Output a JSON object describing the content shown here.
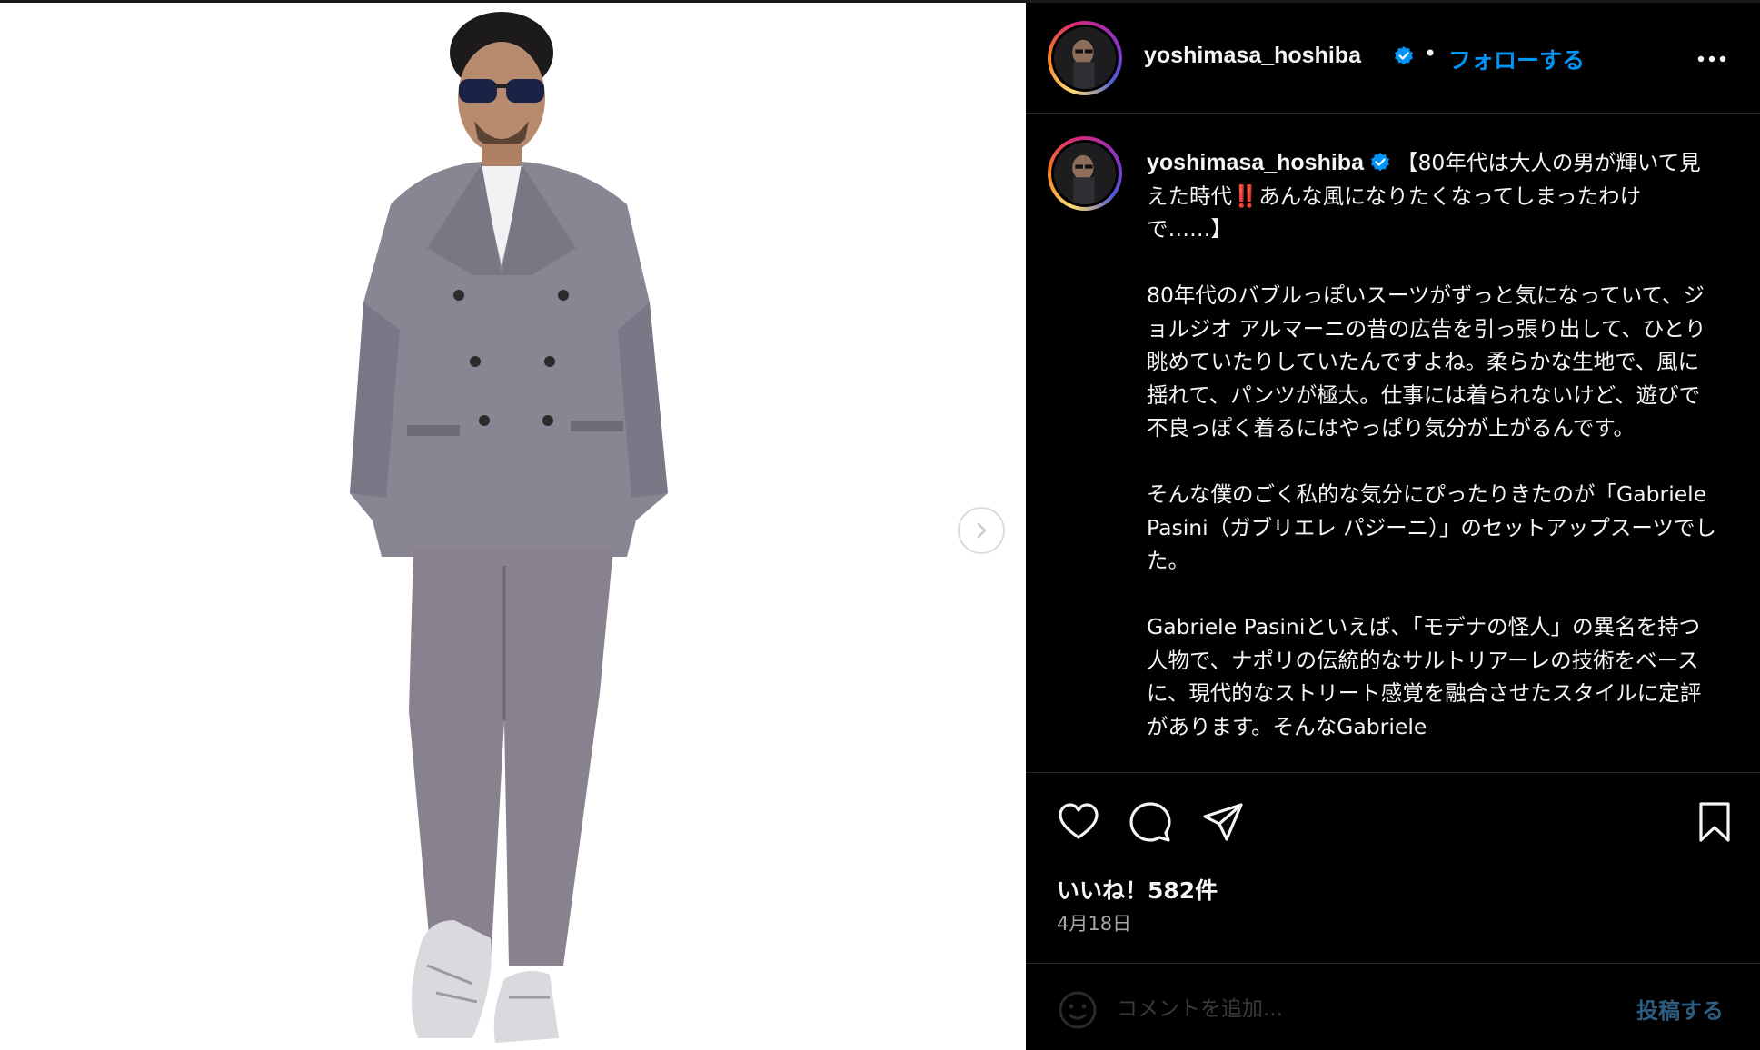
{
  "post": {
    "username": "yoshimasa_hoshiba",
    "separator": "•",
    "follow_label": "フォローする",
    "more_icon": "more-horizontal-icon",
    "verified_icon": "verified-badge-icon"
  },
  "caption": {
    "username": "yoshimasa_hoshiba",
    "line1_a": "【80年代は大人の男が輝いて見えた時代",
    "emoji_double_exclamation": "‼️",
    "line1_b": "あんな風になりたくなってしまったわけで……】",
    "para1": "80年代のバブルっぽいスーツがずっと気になっていて、ジョルジオ アルマーニの昔の広告を引っ張り出して、ひとり眺めていたりしていたんですよね。柔らかな生地で、風に揺れて、パンツが極太。仕事には着られないけど、遊びで不良っぽく着るにはやっぱり気分が上がるんです。",
    "para2": "そんな僕のごく私的な気分にぴったりきたのが「Gabriele Pasini（ガブリエレ パジーニ）」のセットアップスーツでした。",
    "para3": "Gabriele Pasiniといえば、「モデナの怪人」の異名を持つ人物で、ナポリの伝統的なサルトリアーレの技術をベースに、現代的なストリート感覚を融合させたスタイルに定評があります。そんなGabriele"
  },
  "actions": {
    "likes": "いいね！582件",
    "date": "4月18日",
    "icons": [
      "heart-icon",
      "comment-icon",
      "share-icon",
      "bookmark-icon"
    ]
  },
  "comment_bar": {
    "placeholder": "コメントを追加...",
    "post_label": "投稿する"
  },
  "colors": {
    "accent": "#0095f6",
    "background": "#000000",
    "text": "#f5f5f5",
    "muted": "#a8a8a8",
    "photo_background": "#ffffff"
  }
}
